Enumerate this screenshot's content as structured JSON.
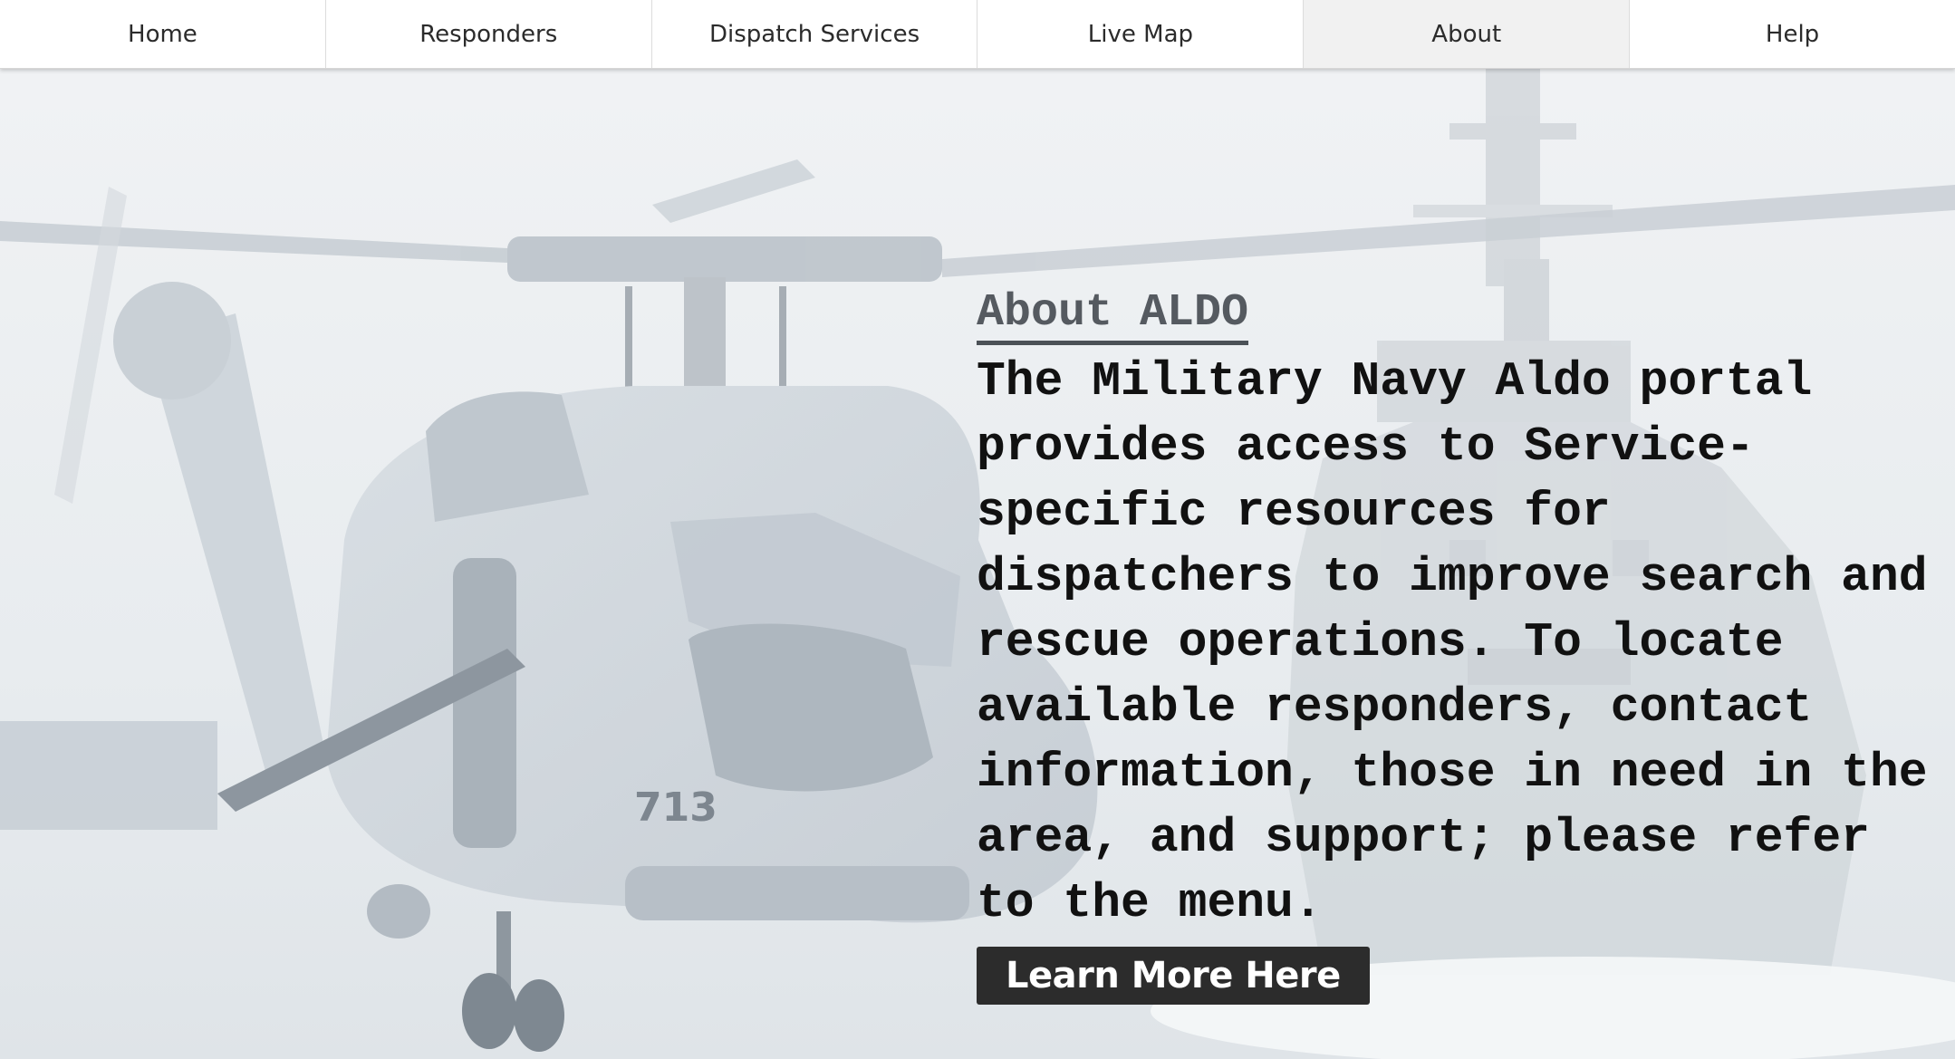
{
  "nav": {
    "items": [
      {
        "label": "Home"
      },
      {
        "label": "Responders"
      },
      {
        "label": "Dispatch Services"
      },
      {
        "label": "Live Map"
      },
      {
        "label": "About"
      },
      {
        "label": "Help"
      }
    ],
    "active": "About"
  },
  "hero": {
    "background_image": "navy helicopter and ship photo",
    "helicopter_number": "713",
    "title": "About ALDO",
    "body": "The Military Navy Aldo portal provides access to Service-specific resources for dispatchers to improve search and rescue operations. To locate available responders, contact information, those in need in the area, and support; please refer to the menu.",
    "button_label": "Learn More Here"
  },
  "colors": {
    "nav_bg": "#ffffff",
    "nav_active_bg": "#f1f1f1",
    "title_color": "#555a60",
    "body_color": "#111111",
    "button_bg": "#2c2c2c",
    "button_text": "#ffffff"
  }
}
